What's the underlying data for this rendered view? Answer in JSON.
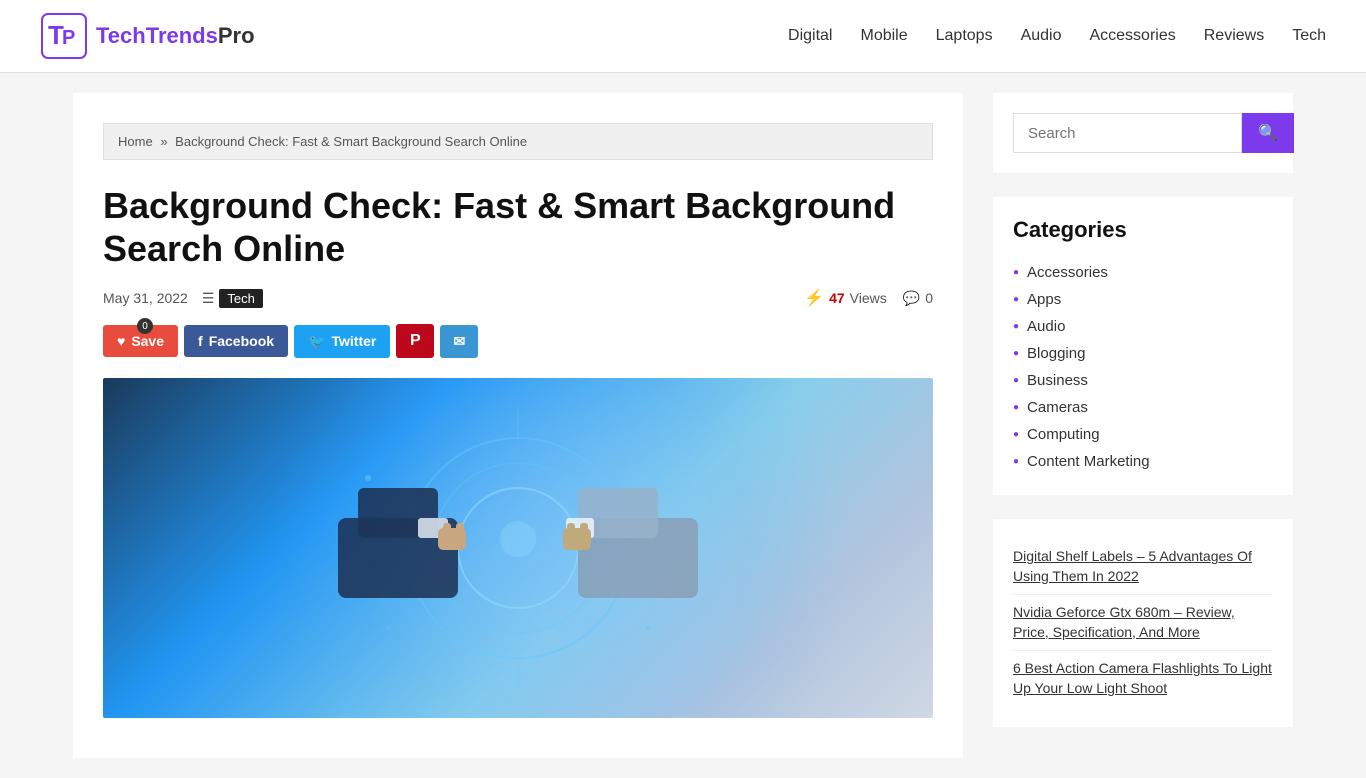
{
  "site": {
    "logo_text_part1": "TechTrends",
    "logo_text_part2": "Pro"
  },
  "nav": {
    "items": [
      {
        "label": "Digital",
        "href": "#"
      },
      {
        "label": "Mobile",
        "href": "#"
      },
      {
        "label": "Laptops",
        "href": "#"
      },
      {
        "label": "Audio",
        "href": "#"
      },
      {
        "label": "Accessories",
        "href": "#"
      },
      {
        "label": "Reviews",
        "href": "#"
      },
      {
        "label": "Tech",
        "href": "#"
      }
    ]
  },
  "breadcrumb": {
    "home_label": "Home",
    "separator": "»",
    "current": "Background Check: Fast & Smart Background Search Online"
  },
  "article": {
    "title": "Background Check: Fast & Smart Background Search Online",
    "date": "May 31, 2022",
    "tag": "Tech",
    "views_count": "47",
    "views_label": "Views",
    "comments_count": "0",
    "save_label": "Save",
    "save_badge": "0",
    "facebook_label": "Facebook",
    "twitter_label": "Twitter"
  },
  "sidebar": {
    "search_placeholder": "Search",
    "categories_title": "Categories",
    "categories": [
      {
        "label": "Accessories"
      },
      {
        "label": "Apps"
      },
      {
        "label": "Audio"
      },
      {
        "label": "Blogging"
      },
      {
        "label": "Business"
      },
      {
        "label": "Cameras"
      },
      {
        "label": "Computing"
      },
      {
        "label": "Content Marketing"
      }
    ],
    "recent_posts": [
      {
        "label": "Digital Shelf Labels – 5 Advantages Of Using Them In 2022"
      },
      {
        "label": "Nvidia Geforce Gtx 680m – Review, Price, Specification, And More"
      },
      {
        "label": "6 Best Action Camera Flashlights To Light Up Your Low Light Shoot"
      }
    ]
  },
  "colors": {
    "brand_purple": "#7c3aed",
    "facebook_blue": "#3b5998",
    "twitter_blue": "#1da1f2",
    "pinterest_red": "#bd081c",
    "save_red": "#e74c3c",
    "email_blue": "#3b97d3"
  }
}
